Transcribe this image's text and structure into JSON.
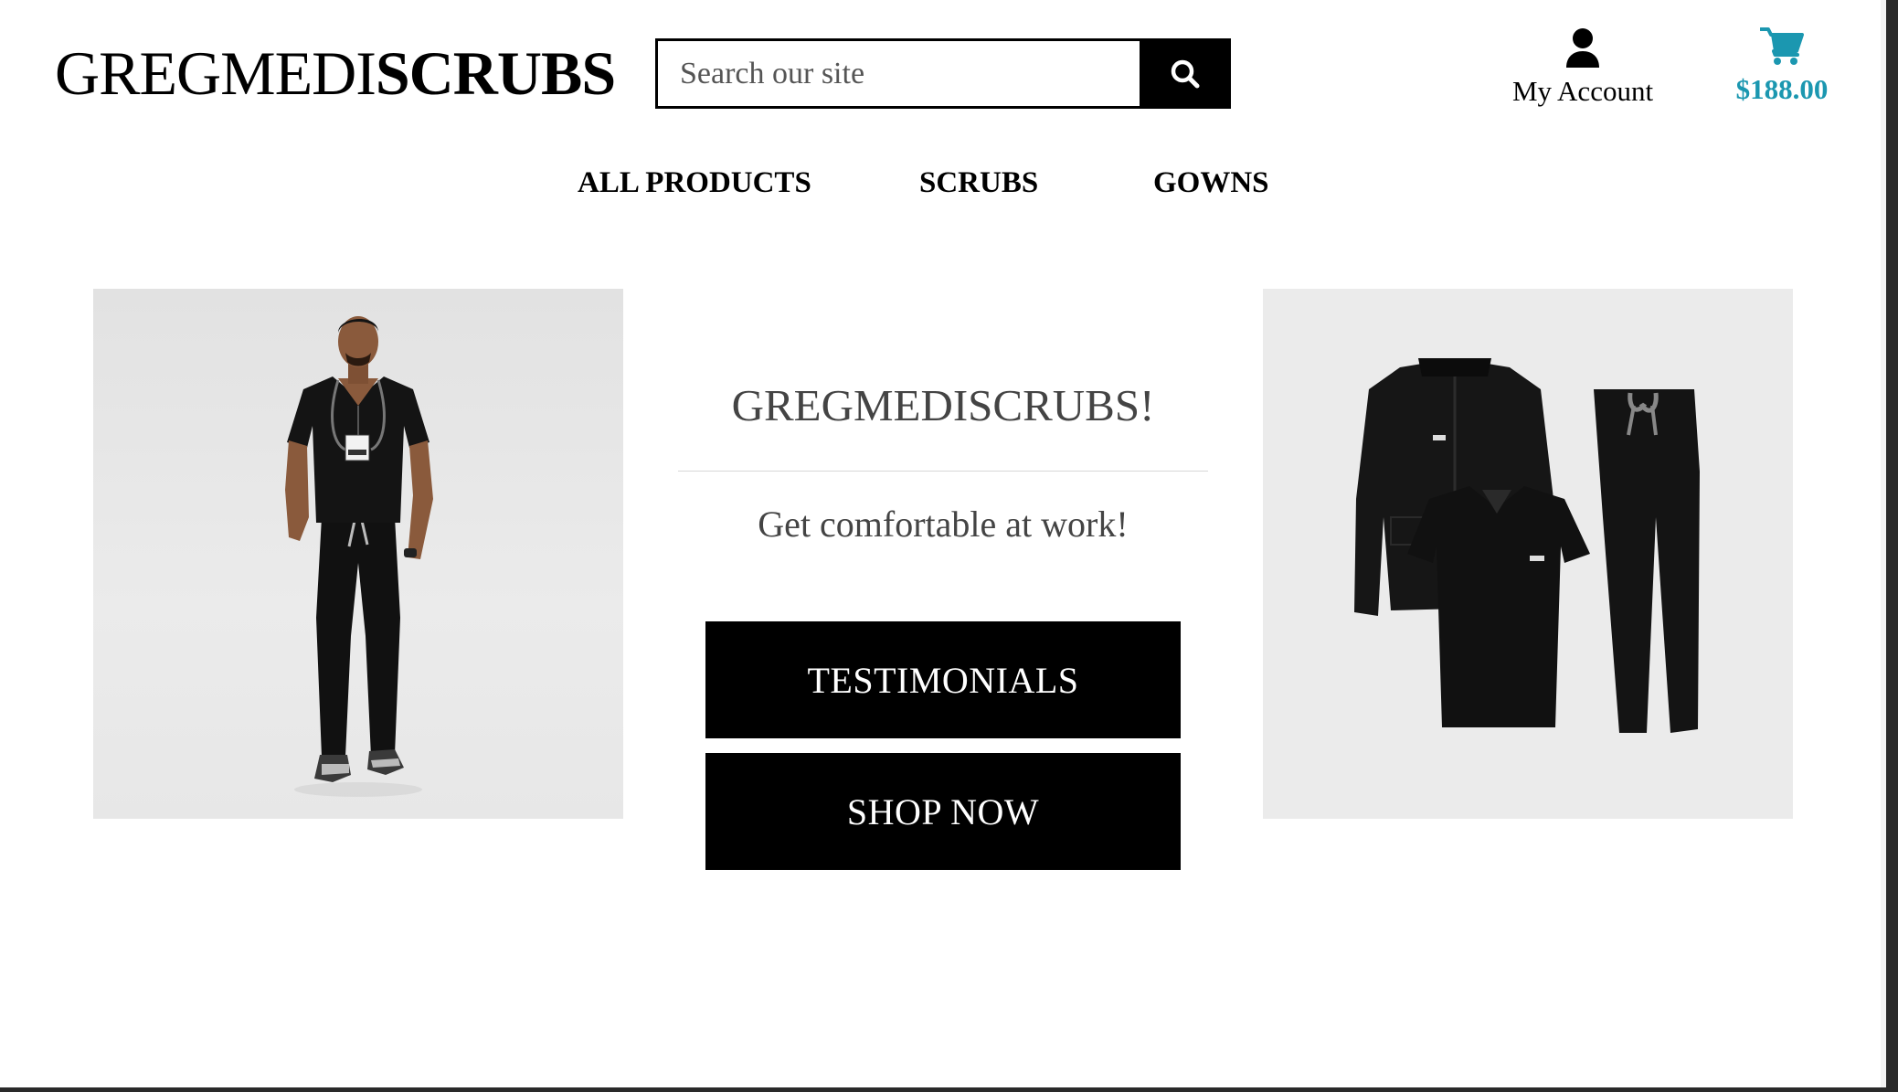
{
  "header": {
    "logo_light": "GREGMEDI",
    "logo_bold": "SCRUBS",
    "search_placeholder": "Search our site",
    "search_icon": "search-icon",
    "account_label": "My Account",
    "account_icon": "user-icon",
    "cart_total": "$188.00",
    "cart_icon": "shopping-cart-icon"
  },
  "nav": {
    "items": [
      {
        "label": "ALL PRODUCTS"
      },
      {
        "label": "SCRUBS"
      },
      {
        "label": "GOWNS"
      }
    ]
  },
  "hero": {
    "title": "GREGMEDISCRUBS!",
    "tagline": "Get comfortable at work!",
    "testimonials_label": "TESTIMONIALS",
    "shop_now_label": "SHOP NOW"
  },
  "colors": {
    "accent": "#1b97b0",
    "button_bg": "#000000",
    "button_text": "#ffffff",
    "hero_bg": "#ebebeb"
  }
}
